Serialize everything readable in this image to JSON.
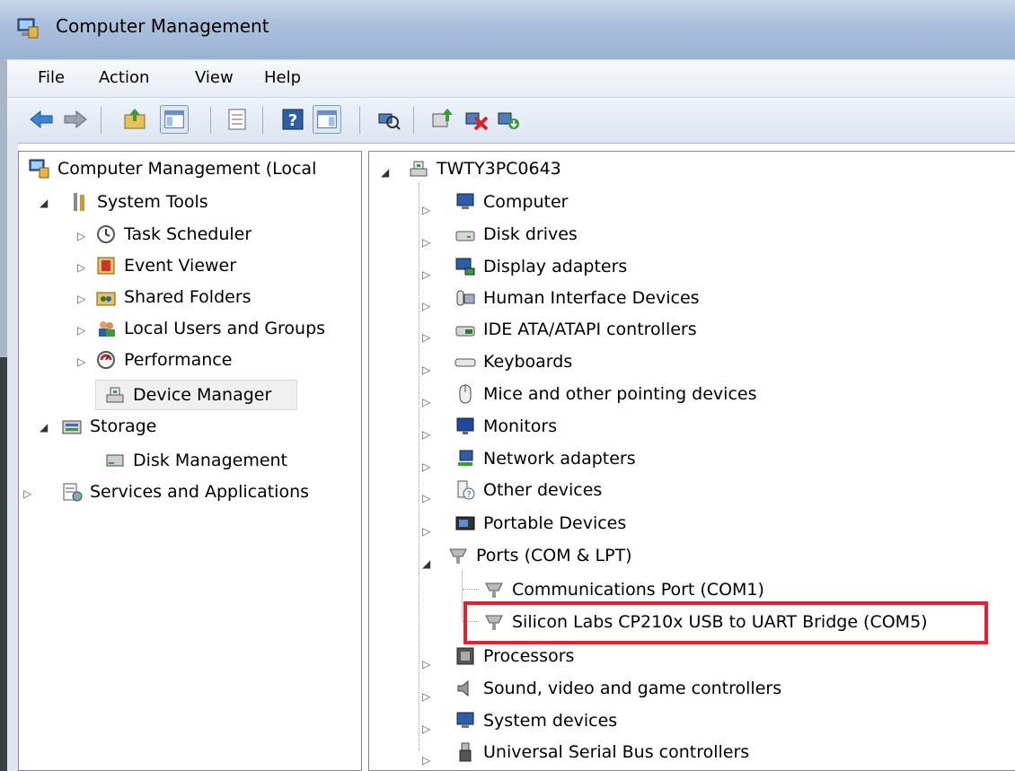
{
  "window": {
    "title": "Computer Management"
  },
  "menu": [
    "File",
    "Action",
    "View",
    "Help"
  ],
  "left_tree": {
    "root": "Computer Management (Local",
    "system_tools": "System Tools",
    "task_scheduler": "Task Scheduler",
    "event_viewer": "Event Viewer",
    "shared_folders": "Shared Folders",
    "local_users": "Local Users and Groups",
    "performance": "Performance",
    "device_manager": "Device Manager",
    "storage": "Storage",
    "disk_management": "Disk Management",
    "services": "Services and Applications"
  },
  "device_tree": {
    "computer_name": "TWTY3PC0643",
    "categories": [
      "Computer",
      "Disk drives",
      "Display adapters",
      "Human Interface Devices",
      "IDE ATA/ATAPI controllers",
      "Keyboards",
      "Mice and other pointing devices",
      "Monitors",
      "Network adapters",
      "Other devices",
      "Portable Devices",
      "Ports (COM & LPT)",
      "Processors",
      "Sound, video and game controllers",
      "System devices",
      "Universal Serial Bus controllers"
    ],
    "ports_children": [
      "Communications Port (COM1)",
      "Silicon Labs CP210x USB to UART Bridge (COM5)"
    ]
  },
  "colors": {
    "highlight": "#e3202f",
    "title_bar": "#aac0dc"
  }
}
